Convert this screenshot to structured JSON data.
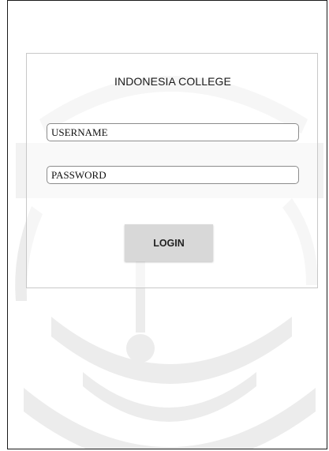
{
  "login_form": {
    "title": "INDONESIA COLLEGE",
    "username": {
      "placeholder": "USERNAME",
      "value": ""
    },
    "password": {
      "placeholder": "PASSWORD",
      "value": ""
    },
    "login_label": "LOGIN"
  },
  "theme": {
    "card_border": "#c8c8c8",
    "button_background": "#d8d8d8",
    "watermark_color": "#ededed"
  },
  "background": {
    "watermark_icon": "islam-university-emblem-icon"
  }
}
